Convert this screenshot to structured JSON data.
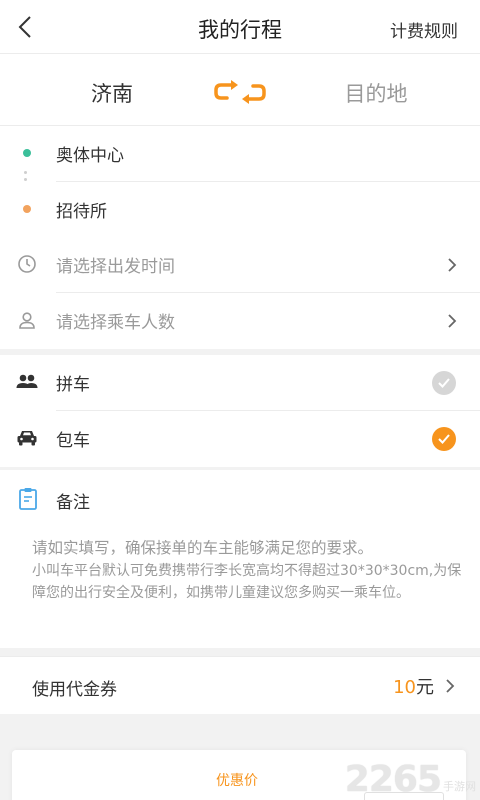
{
  "header": {
    "title": "我的行程",
    "right_link": "计费规则"
  },
  "route": {
    "from_city": "济南",
    "to_city": "目的地",
    "swap_icon": "swap-arrows-icon"
  },
  "stops": {
    "start": "奥体中心",
    "end": "招待所"
  },
  "options": {
    "departure_time_placeholder": "请选择出发时间",
    "passengers_placeholder": "请选择乘车人数"
  },
  "ride_types": [
    {
      "label": "拼车",
      "icon": "people-icon",
      "selected": false
    },
    {
      "label": "包车",
      "icon": "car-icon",
      "selected": true
    }
  ],
  "note": {
    "title": "备注",
    "line1": "请如实填写，确保接单的车主能够满足您的要求。",
    "body": "小叫车平台默认可免费携带行李长宽高均不得超过30*30*30cm,为保障您的出行安全及便利，如携带儿童建议您多购买一乘车位。"
  },
  "coupon": {
    "label": "使用代金券",
    "amount": "10",
    "unit": "元"
  },
  "price_card": {
    "label": "优惠价"
  },
  "watermark": {
    "number": "2265",
    "suffix": "手游网"
  },
  "colors": {
    "accent": "#f7941d",
    "start_dot": "#3bbf9a",
    "end_dot": "#f2a35e",
    "note_icon": "#4aa8e8",
    "unselected_check": "#d6d6d6"
  }
}
